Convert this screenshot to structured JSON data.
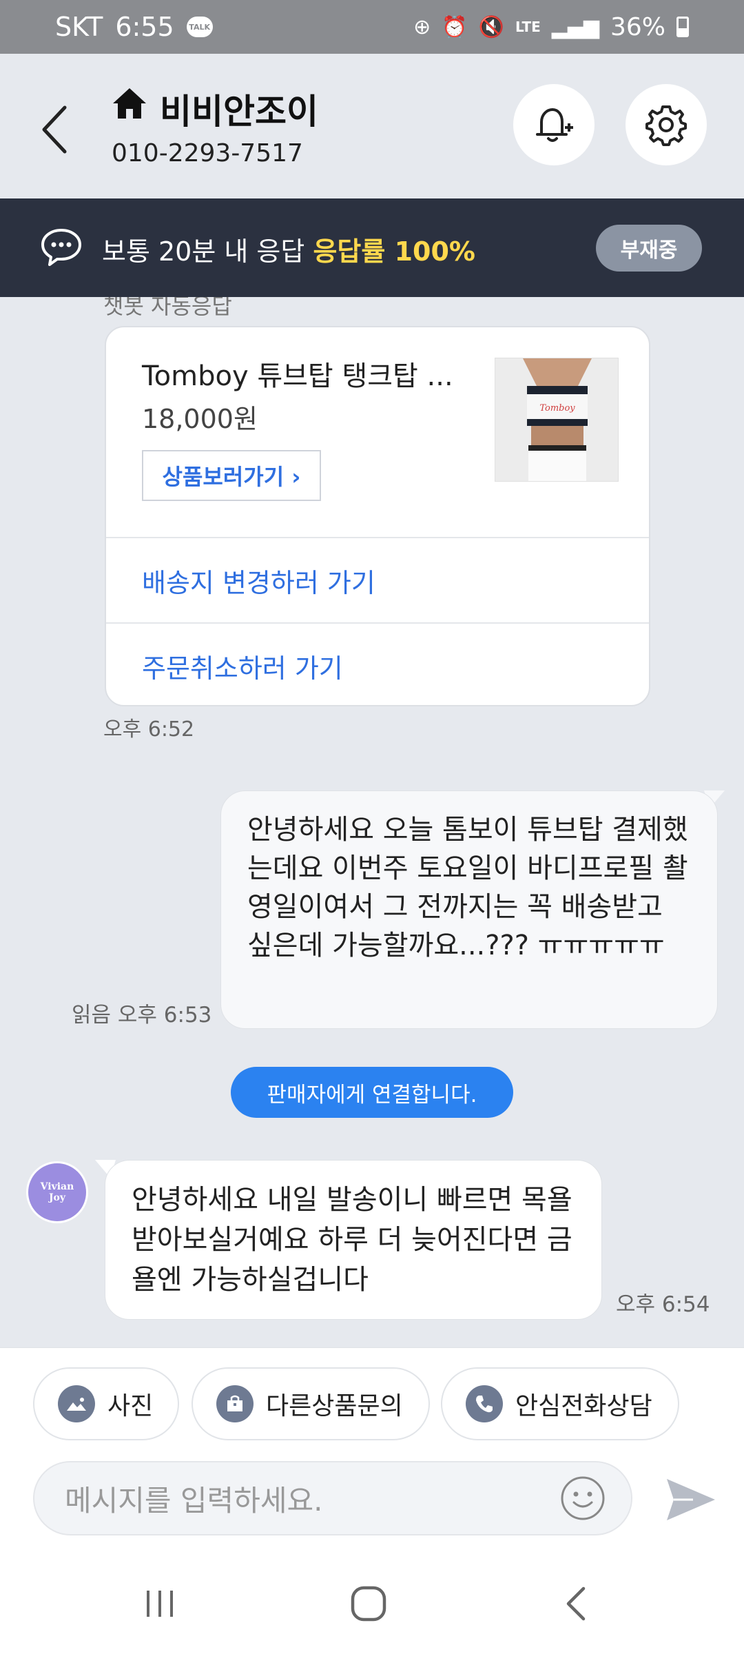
{
  "status_bar": {
    "carrier": "SKT",
    "time": "6:55",
    "talk_badge": "TALK",
    "network": "LTE",
    "battery": "36%"
  },
  "header": {
    "shop_name": "비비안조이",
    "phone": "010-2293-7517"
  },
  "banner": {
    "response_text": "보통 20분 내 응답",
    "response_rate": "응답률 100%",
    "status_badge": "부재중"
  },
  "chat": {
    "bot_label": "챗봇 자동응답",
    "product_card": {
      "name": "Tomboy 튜브탑 탱크탑 ...",
      "price": "18,000원",
      "view_button": "상품보러가기 ›",
      "thumb_text": "Tomboy",
      "link_address": "배송지 변경하러 가기",
      "link_cancel": "주문취소하러 가기"
    },
    "bot_time": "오후 6:52",
    "outgoing_message": "안녕하세요 오늘 톰보이 튜브탑 결제했는데요 이번주 토요일이 바디프로필 촬영일이여서 그 전까지는 꼭 배송받고 싶은데 가능할까요...??? ㅠㅠㅠㅠㅠ",
    "outgoing_status": "읽음 오후 6:53",
    "system_notice": "판매자에게 연결합니다.",
    "avatar_text_line1": "Vivian",
    "avatar_text_line2": "Joy",
    "incoming_message": "안녕하세요 내일 발송이니 빠르면 목욜 받아보실거예요 하루 더 늦어진다면 금욜엔 가능하실겁니다",
    "incoming_time": "오후 6:54"
  },
  "actions": {
    "photo": "사진",
    "other_inquiry": "다른상품문의",
    "safe_call": "안심전화상담"
  },
  "input": {
    "placeholder": "메시지를 입력하세요."
  },
  "icons": {
    "accent": "#2b82f0",
    "link_color": "#2f6fe0",
    "banner_bg": "#2b3140",
    "rate_color": "#ffd84d"
  }
}
